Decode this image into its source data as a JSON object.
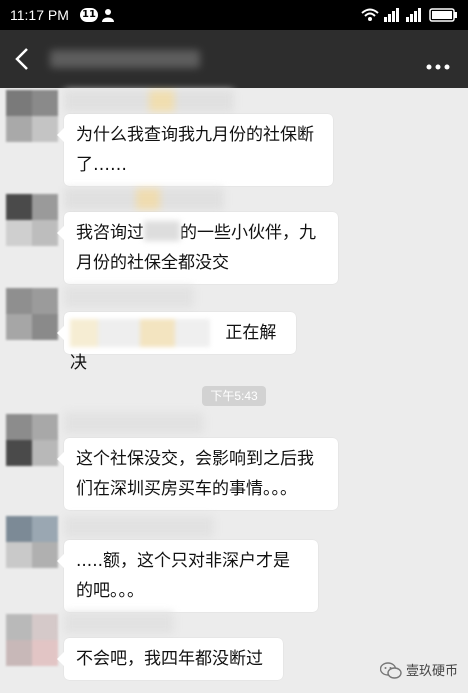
{
  "status_bar": {
    "time": "11:17 PM",
    "notification_count": "11"
  },
  "nav": {
    "title": ""
  },
  "messages": [
    {
      "id": 1,
      "text": "为什么我查询我九月份的社保断了……"
    },
    {
      "id": 2,
      "text_before": "我咨询过",
      "text_after": "的一些小伙伴，九月份的社保全都没交"
    },
    {
      "id": 3,
      "text": "正在解决"
    },
    {
      "id": 4,
      "text": "这个社保没交，会影响到之后我们在深圳买房买车的事情。。。"
    },
    {
      "id": 5,
      "text": ".....额，这个只对非深户才是的吧。。。"
    },
    {
      "id": 6,
      "text": "不会吧，我四年都没断过"
    }
  ],
  "timestamp": "下午5:43",
  "watermark": "壹玖硬币",
  "colors": {
    "status_bar": "#000000",
    "nav_bar": "#2d2d2d",
    "background": "#ececec",
    "bubble": "#ffffff"
  }
}
